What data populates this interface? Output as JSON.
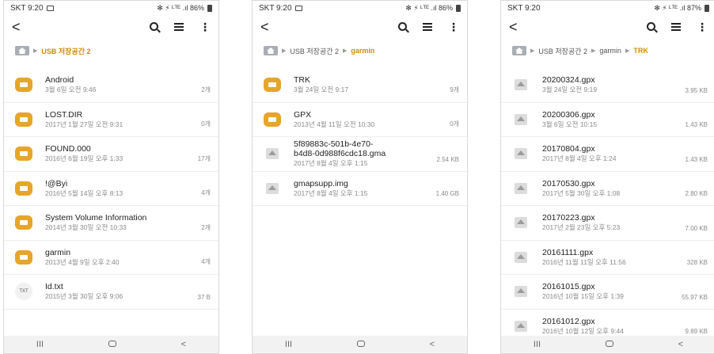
{
  "screens": [
    {
      "status": {
        "carrier": "SKT 9:20",
        "right": "✻ ⚡ ᴸᵀᴱ .ıl 86%"
      },
      "breadcrumb": {
        "path": [
          "USB 저장공간 2"
        ]
      },
      "rows": [
        {
          "type": "folder",
          "name": "Android",
          "date": "3월 6일 오전 9:46",
          "size": "2개"
        },
        {
          "type": "folder",
          "name": "LOST.DIR",
          "date": "2017년 1월 27일 오전 9:31",
          "size": "0개"
        },
        {
          "type": "folder",
          "name": "FOUND.000",
          "date": "2016년 6월 19일 오후 1:33",
          "size": "17개"
        },
        {
          "type": "folder",
          "name": "!@Byi",
          "date": "2016년 5월 14일 오후 8:13",
          "size": "4개"
        },
        {
          "type": "folder",
          "name": "System Volume Information",
          "date": "2014년 3월 30일 오전 10:33",
          "size": "2개"
        },
        {
          "type": "folder",
          "name": "garmin",
          "date": "2013년 4월 9일 오후 2:40",
          "size": "4개"
        },
        {
          "type": "txt",
          "name": "Id.txt",
          "date": "2015년 3월 30일 오후 9:06",
          "size": "37 B",
          "icon_label": "TXT"
        }
      ]
    },
    {
      "status": {
        "carrier": "SKT 9:20",
        "right": "✻ ⚡ ᴸᵀᴱ .ıl 86%"
      },
      "breadcrumb": {
        "path": [
          "USB 저장공간 2",
          "garmin"
        ]
      },
      "rows": [
        {
          "type": "folder",
          "name": "TRK",
          "date": "3월 24일 오전 9:17",
          "size": "9개"
        },
        {
          "type": "folder",
          "name": "GPX",
          "date": "2013년 4월 11일 오전 10:30",
          "size": "0개"
        },
        {
          "type": "file",
          "name": "5f89883c-501b-4e70-",
          "name2": "b4d8-0d988f6cdc18.gma",
          "date": "2017년 8월 4일 오후 1:15",
          "size": "2.54 KB"
        },
        {
          "type": "file",
          "name": "gmapsupp.img",
          "date": "2017년 8월 4일 오후 1:15",
          "size": "1.40 GB"
        }
      ]
    },
    {
      "status": {
        "carrier": "SKT 9:20",
        "right": "✻ ⚡ ᴸᵀᴱ .ıl 87%"
      },
      "breadcrumb": {
        "path": [
          "USB 저장공간 2",
          "garmin",
          "TRK"
        ]
      },
      "rows": [
        {
          "type": "file",
          "name": "20200324.gpx",
          "date": "3월 24일 오전 9:19",
          "size": "3.95 KB"
        },
        {
          "type": "file",
          "name": "20200306.gpx",
          "date": "3월 6일 오전 10:15",
          "size": "1.43 KB"
        },
        {
          "type": "file",
          "name": "20170804.gpx",
          "date": "2017년 8월 4일 오후 1:24",
          "size": "1.43 KB"
        },
        {
          "type": "file",
          "name": "20170530.gpx",
          "date": "2017년 5월 30일 오후 1:08",
          "size": "2.80 KB"
        },
        {
          "type": "file",
          "name": "20170223.gpx",
          "date": "2017년 2월 23일 오후 5:23",
          "size": "7.00 KB"
        },
        {
          "type": "file",
          "name": "20161111.gpx",
          "date": "2016년 11월 11일 오후 11:56",
          "size": "328 KB"
        },
        {
          "type": "file",
          "name": "20161015.gpx",
          "date": "2016년 10월 15일 오후 1:39",
          "size": "55.97 KB"
        },
        {
          "type": "file",
          "name": "20161012.gpx",
          "date": "2016년 10월 12일 오후 9:44",
          "size": "9.89 KB"
        }
      ]
    }
  ],
  "toolbar": {
    "back": "<",
    "more": "⋮"
  },
  "navbar": {
    "recents": "III",
    "back": "<"
  },
  "colors": {
    "folder": "#e7a52a",
    "crumb_active": "#d28c00"
  }
}
